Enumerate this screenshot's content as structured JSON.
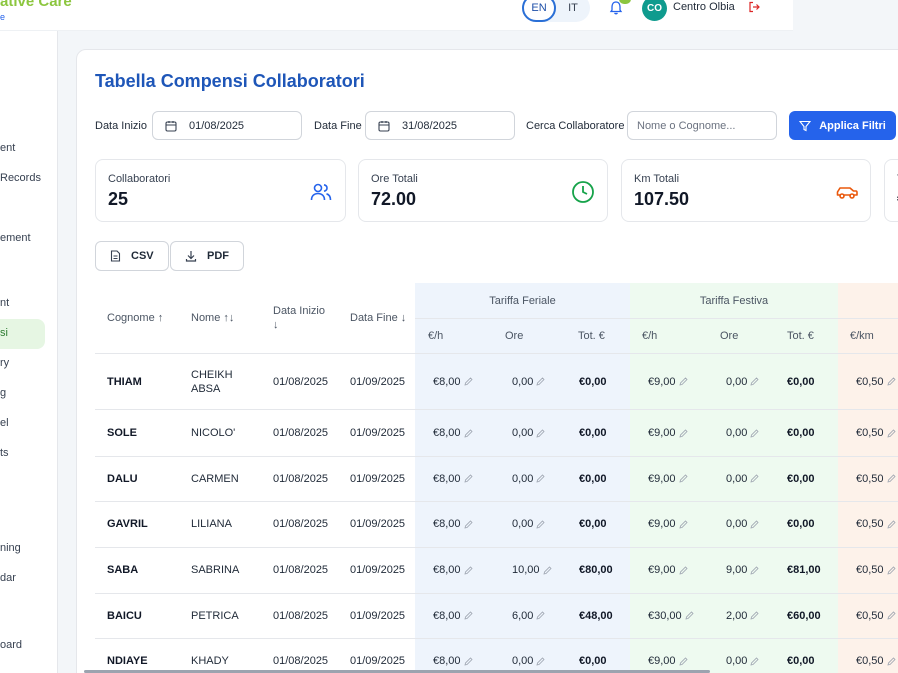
{
  "header": {
    "brand": "ative Care",
    "brand_sub": "e",
    "lang_en": "EN",
    "lang_it": "IT",
    "avatar_initials": "CO",
    "user_name": "Centro Olbia",
    "colors": {
      "brand_green": "#8cc63f",
      "primary": "#2563eb",
      "avatar": "#0f9b8e"
    }
  },
  "sidebar": {
    "items": [
      "ent",
      "Records",
      "ement",
      "nt",
      "si",
      "ry",
      "g",
      "el",
      "ts",
      "ning",
      "dar",
      "oard"
    ]
  },
  "page": {
    "title": "Tabella Compensi Collaboratori"
  },
  "filters": {
    "start_label": "Data Inizio",
    "start_value": "01/08/2025",
    "end_label": "Data Fine",
    "end_value": "31/08/2025",
    "search_label": "Cerca Collaboratore",
    "search_placeholder": "Nome o Cognome...",
    "apply_label": "Applica Filtri"
  },
  "stats": [
    {
      "label": "Collaboratori",
      "value": "25",
      "icon": "users-icon",
      "color": "#2563eb"
    },
    {
      "label": "Ore Totali",
      "value": "72.00",
      "icon": "clock-icon",
      "color": "#16a34a"
    },
    {
      "label": "Km Totali",
      "value": "107.50",
      "icon": "car-icon",
      "color": "#ea580c"
    },
    {
      "label": "T",
      "value": "€",
      "icon": "",
      "color": ""
    }
  ],
  "export": {
    "csv": "CSV",
    "pdf": "PDF"
  },
  "table": {
    "columns": {
      "cognome": "Cognome ↑",
      "nome": "Nome ↑↓",
      "data_inizio": "Data Inizio ↓",
      "data_fine": "Data Fine ↓"
    },
    "groups": {
      "feriale": "Tariffa Feriale",
      "festiva": "Tariffa Festiva"
    },
    "sub": {
      "rate": "€/h",
      "ore": "Ore",
      "tot": "Tot. €",
      "km": "€/km"
    },
    "rows": [
      {
        "cognome": "THIAM",
        "nome": "CHEIKH ABSA",
        "inizio": "01/08/2025",
        "fine": "01/09/2025",
        "fer_rate": "€8,00",
        "fer_ore": "0,00",
        "fer_tot": "€0,00",
        "fes_rate": "€9,00",
        "fes_ore": "0,00",
        "fes_tot": "€0,00",
        "km": "€0,50"
      },
      {
        "cognome": "SOLE",
        "nome": "NICOLO'",
        "inizio": "01/08/2025",
        "fine": "01/09/2025",
        "fer_rate": "€8,00",
        "fer_ore": "0,00",
        "fer_tot": "€0,00",
        "fes_rate": "€9,00",
        "fes_ore": "0,00",
        "fes_tot": "€0,00",
        "km": "€0,50"
      },
      {
        "cognome": "DALU",
        "nome": "CARMEN",
        "inizio": "01/08/2025",
        "fine": "01/09/2025",
        "fer_rate": "€8,00",
        "fer_ore": "0,00",
        "fer_tot": "€0,00",
        "fes_rate": "€9,00",
        "fes_ore": "0,00",
        "fes_tot": "€0,00",
        "km": "€0,50"
      },
      {
        "cognome": "GAVRIL",
        "nome": "LILIANA",
        "inizio": "01/08/2025",
        "fine": "01/09/2025",
        "fer_rate": "€8,00",
        "fer_ore": "0,00",
        "fer_tot": "€0,00",
        "fes_rate": "€9,00",
        "fes_ore": "0,00",
        "fes_tot": "€0,00",
        "km": "€0,50"
      },
      {
        "cognome": "SABA",
        "nome": "SABRINA",
        "inizio": "01/08/2025",
        "fine": "01/09/2025",
        "fer_rate": "€8,00",
        "fer_ore": "10,00",
        "fer_tot": "€80,00",
        "fes_rate": "€9,00",
        "fes_ore": "9,00",
        "fes_tot": "€81,00",
        "km": "€0,50"
      },
      {
        "cognome": "BAICU",
        "nome": "PETRICA",
        "inizio": "01/08/2025",
        "fine": "01/09/2025",
        "fer_rate": "€8,00",
        "fer_ore": "6,00",
        "fer_tot": "€48,00",
        "fes_rate": "€30,00",
        "fes_ore": "2,00",
        "fes_tot": "€60,00",
        "km": "€0,50"
      },
      {
        "cognome": "NDIAYE",
        "nome": "KHADY",
        "inizio": "01/08/2025",
        "fine": "01/09/2025",
        "fer_rate": "€8,00",
        "fer_ore": "0,00",
        "fer_tot": "€0,00",
        "fes_rate": "€9,00",
        "fes_ore": "0,00",
        "fes_tot": "€0,00",
        "km": "€0,50"
      }
    ]
  }
}
